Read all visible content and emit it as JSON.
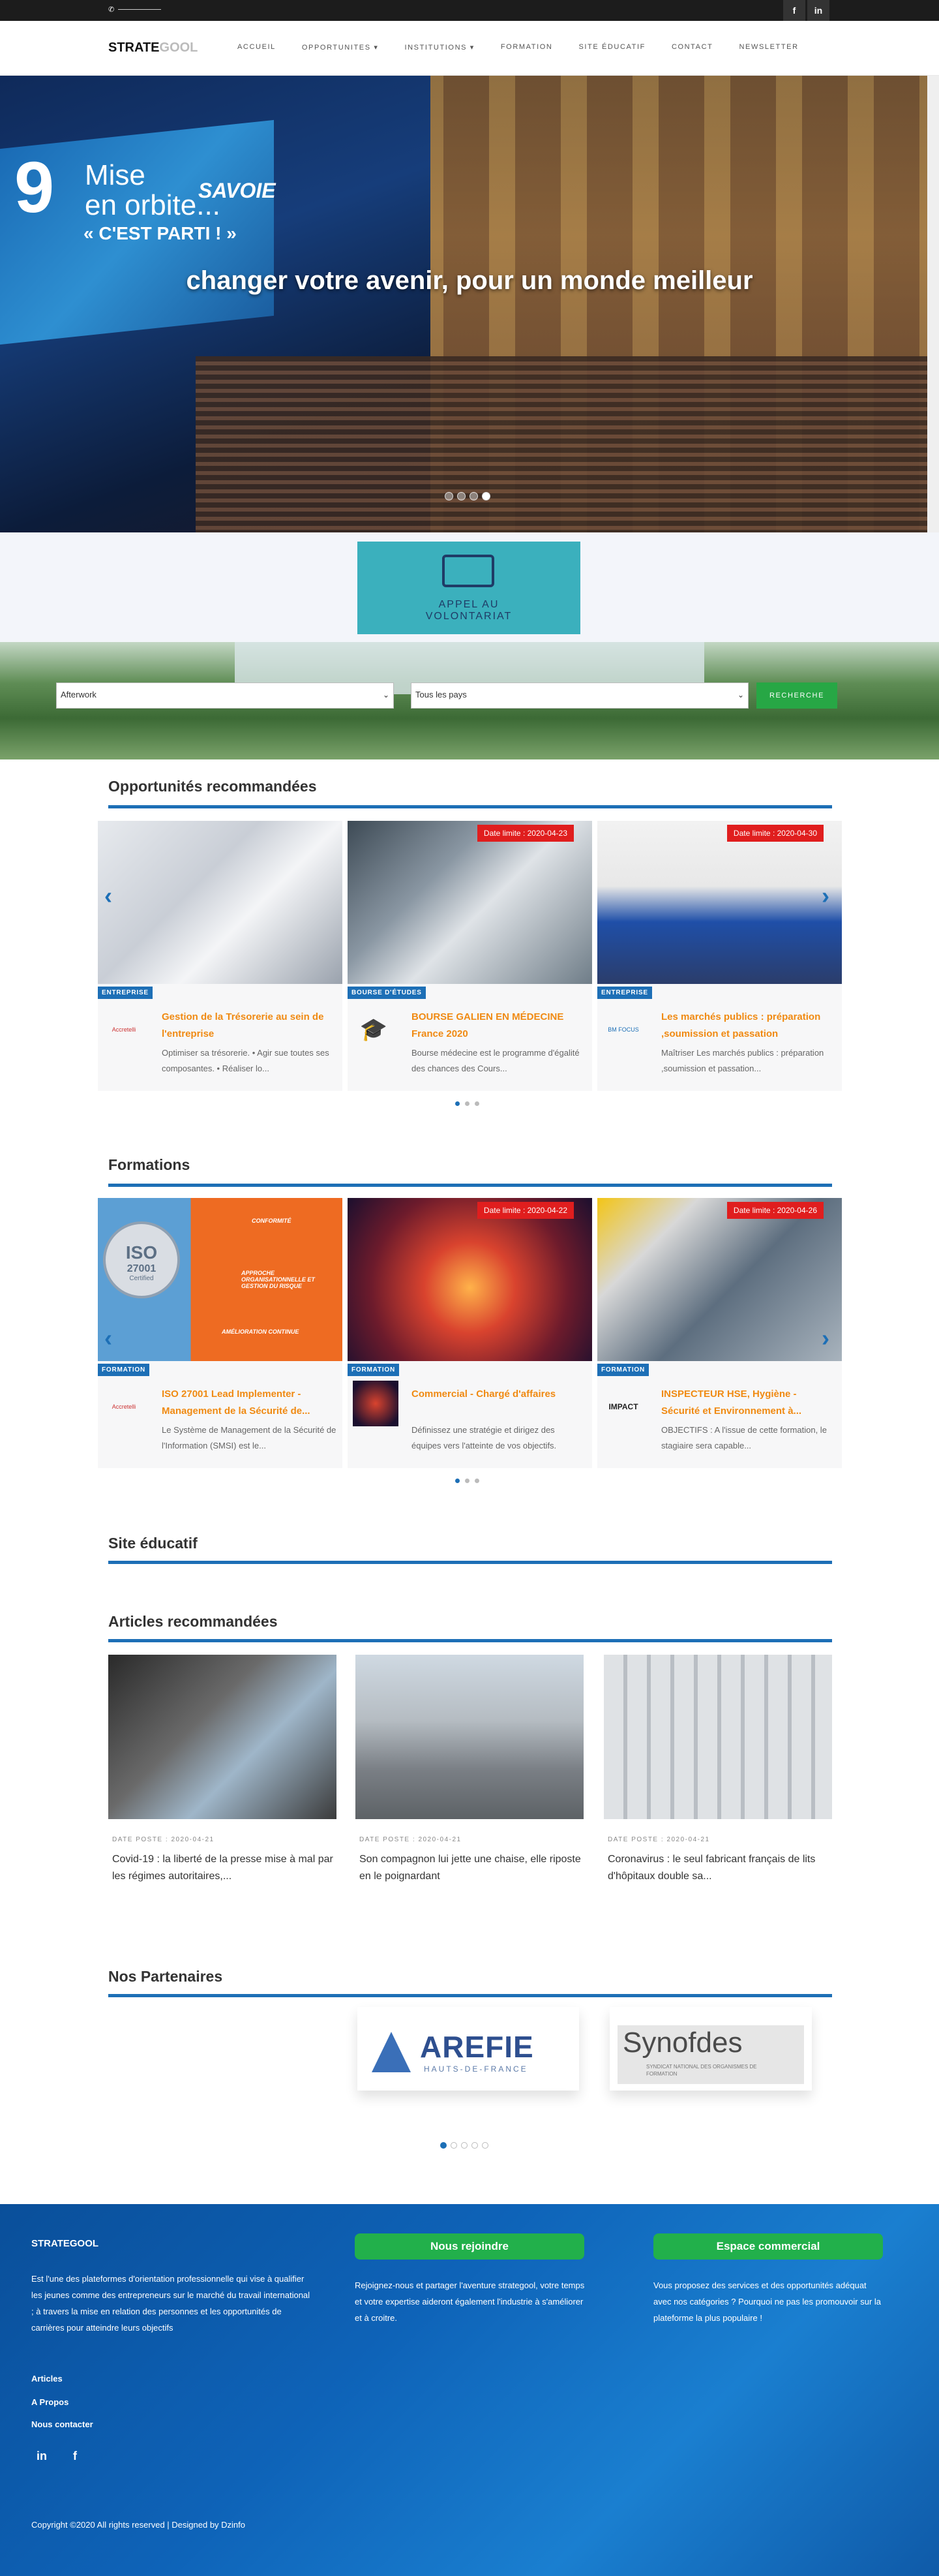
{
  "topbar": {
    "social": [
      "f",
      "in"
    ]
  },
  "nav": {
    "logo_main": "STRATE",
    "logo_light": "GOOL",
    "items": [
      "ACCUEIL",
      "OPPORTUNITES ▾",
      "INSTITUTIONS ▾",
      "FORMATION",
      "SITE ÉDUCATIF",
      "CONTACT",
      "NEWSLETTER"
    ]
  },
  "hero": {
    "title": "changer votre avenir, pour un monde meilleur",
    "screen_number": "9",
    "screen_line1": "Mise",
    "screen_line2": "en orbite...",
    "screen_line3": "« C'EST PARTI ! »",
    "screen_brand": "SAVOIE",
    "slides": 4,
    "active_slide": 4
  },
  "banner": {
    "text_line1": "APPEL AU",
    "text_line2": "VOLONTARIAT"
  },
  "search": {
    "select1": "Afterwork",
    "select2": "Tous les pays",
    "button": "RECHERCHE"
  },
  "opportunites": {
    "title": "Opportunités recommandées",
    "cards": [
      {
        "category": "ENTREPRISE",
        "date": "",
        "thumb": "Accretelli",
        "title": "Gestion de la Trésorerie au sein de l'entreprise",
        "desc": "Optimiser sa trésorerie. • Agir sue toutes ses composantes. • Réaliser lo..."
      },
      {
        "category": "BOURSE D'ÉTUDES",
        "date": "Date limite : 2020-04-23",
        "thumb": "",
        "title": "BOURSE GALIEN EN MÉDECINE France 2020",
        "desc": "Bourse médecine est le programme d'égalité des chances des Cours..."
      },
      {
        "category": "ENTREPRISE",
        "date": "Date limite : 2020-04-30",
        "thumb": "BM FOCUS",
        "title": "Les marchés publics : préparation ,soumission et passation",
        "desc": "Maîtriser Les marchés publics : préparation ,soumission et passation..."
      }
    ]
  },
  "formations": {
    "title": "Formations",
    "cards": [
      {
        "category": "FORMATION",
        "date": "",
        "thumb": "Accretelli",
        "title": "ISO 27001 Lead Implementer - Management de la Sécurité de...",
        "desc": "Le Système de Management de la Sécurité de l'Information (SMSI) est le..."
      },
      {
        "category": "FORMATION",
        "date": "Date limite : 2020-04-22",
        "thumb": "",
        "title": "Commercial - Chargé d'affaires",
        "desc": "Définissez une stratégie et dirigez des équipes vers l'atteinte de vos objectifs."
      },
      {
        "category": "FORMATION",
        "date": "Date limite : 2020-04-26",
        "thumb": "IMPACT",
        "title": "INSPECTEUR HSE, Hygiène - Sécurité et Environnement à...",
        "desc": "OBJECTIFS : A l'issue de cette formation, le stagiaire sera capable..."
      }
    ],
    "iso_items": [
      "CONFORMITÉ",
      "APPROCHE ORGANISATIONNELLE ET GESTION DU RISQUE",
      "AMÉLIORATION CONTINUE"
    ],
    "iso_badge": "ISO",
    "iso_number": "27001",
    "iso_certified": "Certified"
  },
  "site_educatif": {
    "title": "Site éducatif"
  },
  "articles": {
    "title": "Articles recommandées",
    "items": [
      {
        "date": "DATE POSTE : 2020-04-21",
        "title": "Covid-19 : la liberté de la presse mise à mal par les régimes autoritaires,..."
      },
      {
        "date": "DATE POSTE : 2020-04-21",
        "title": "Son compagnon lui jette une chaise, elle riposte en le poignardant"
      },
      {
        "date": "DATE POSTE : 2020-04-21",
        "title": "Coronavirus : le seul fabricant français de lits d'hôpitaux double sa..."
      }
    ]
  },
  "partenaires": {
    "title": "Nos Partenaires",
    "items": [
      {
        "name": "AREFIE",
        "sub": "HAUTS-DE-FRANCE"
      },
      {
        "name": "Synofdes",
        "sub": "SYNDICAT NATIONAL DES ORGANISMES DE FORMATION"
      }
    ],
    "dots": 5,
    "active_dot": 1
  },
  "footer": {
    "brand": "STRATEGOOL",
    "description": "Est l'une des plateformes d'orientation professionnelle qui vise à qualifier les jeunes comme des entrepreneurs sur le marché du travail international ; à travers la mise en relation des personnes et les opportunités de carrières pour atteindre leurs objectifs",
    "links": [
      "Articles",
      "A Propos",
      "Nous contacter"
    ],
    "social": [
      "in",
      "f"
    ],
    "join_button": "Nous rejoindre",
    "join_text": "Rejoignez-nous et partager l'aventure strategool, votre temps et votre expertise aideront également l'industrie à s'améliorer et à croitre.",
    "commercial_button": "Espace commercial",
    "commercial_text": "Vous proposez des services et des opportunités adéquat avec nos catégories ? Pourquoi ne pas les promouvoir sur la plateforme la plus populaire !",
    "copyright": "Copyright ©2020 All rights reserved | Designed by Dzinfo"
  },
  "colors": {
    "accent": "#1d6fb6",
    "orange": "#f08a12",
    "deadline": "#e01e1e",
    "green": "#27a745"
  }
}
